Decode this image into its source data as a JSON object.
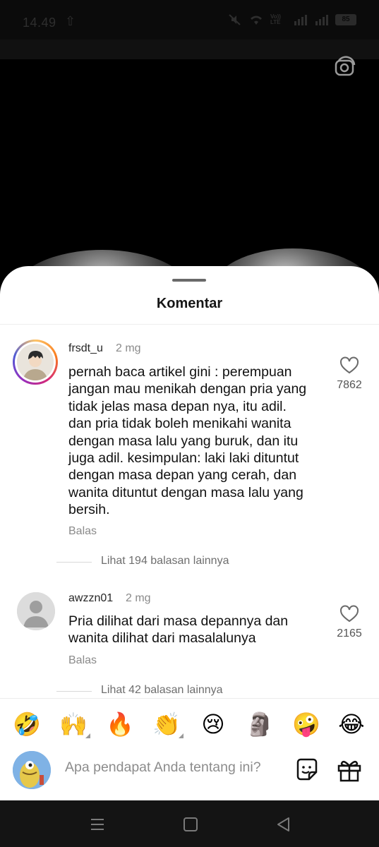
{
  "status_bar": {
    "time": "14.49",
    "upload_glyph": "⇧",
    "icons": [
      "mute-icon",
      "wifi-icon",
      "volte-icon",
      "signal-icon",
      "signal-icon",
      "battery-icon"
    ],
    "volte_text": "Vo)) LTE",
    "battery_level": "85"
  },
  "video": {
    "camera_icon": "camera-flip-icon"
  },
  "sheet": {
    "title": "Komentar"
  },
  "comments": [
    {
      "username": "frsdt_u",
      "time": "2 mg",
      "text": "pernah baca artikel gini : perempuan jangan mau menikah dengan pria yang tidak jelas masa depan nya, itu adil. dan pria tidak boleh menikahi wanita dengan masa lalu yang buruk, dan itu juga adil. kesimpulan: laki laki dituntut dengan masa depan yang cerah, dan wanita dituntut dengan masa lalu yang bersih.",
      "reply_label": "Balas",
      "likes": "7862",
      "more_replies": "Lihat 194 balasan lainnya"
    },
    {
      "username": "awzzn01",
      "time": "2 mg",
      "text": "Pria dilihat dari masa depannya dan wanita dilihat dari masalalunya",
      "reply_label": "Balas",
      "likes": "2165",
      "more_replies": "Lihat 42 balasan lainnya"
    }
  ],
  "emoji_bar": [
    "🤣",
    "🙌",
    "🔥",
    "👏",
    "😢",
    "🗿",
    "🤪",
    "😂"
  ],
  "input": {
    "placeholder": "Apa pendapat Anda tentang ini?"
  },
  "nav": {
    "icons": [
      "recents-icon",
      "home-icon",
      "back-icon"
    ]
  }
}
